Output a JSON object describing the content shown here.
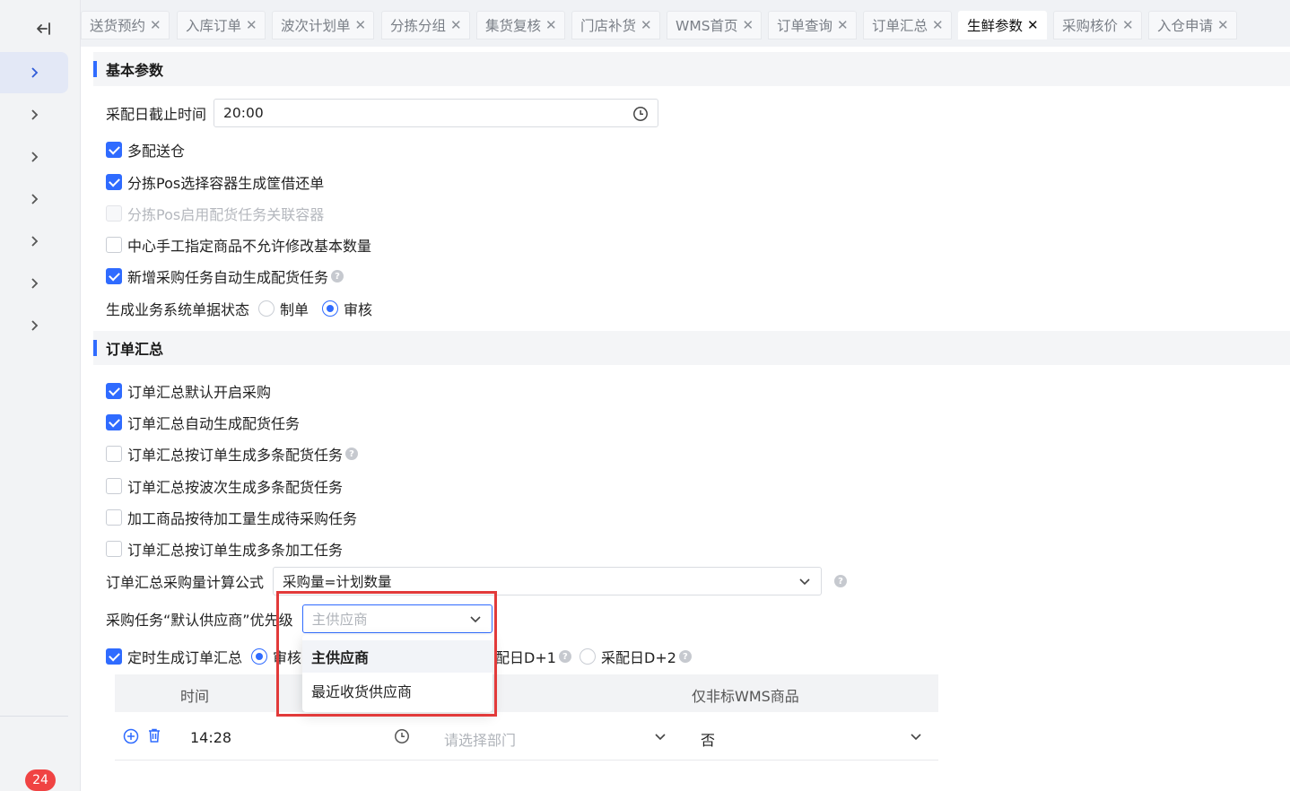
{
  "sidebar": {
    "back_icon": "collapse-left-icon",
    "items": [
      "chevron-right-icon",
      "chevron-right-icon",
      "chevron-right-icon",
      "chevron-right-icon",
      "chevron-right-icon",
      "chevron-right-icon",
      "chevron-right-icon"
    ],
    "badge": "24"
  },
  "tabs": [
    {
      "label": "送货预约"
    },
    {
      "label": "入库订单"
    },
    {
      "label": "波次计划单"
    },
    {
      "label": "分拣分组"
    },
    {
      "label": "集货复核"
    },
    {
      "label": "门店补货"
    },
    {
      "label": "WMS首页"
    },
    {
      "label": "订单查询"
    },
    {
      "label": "订单汇总"
    },
    {
      "label": "生鲜参数",
      "active": true
    },
    {
      "label": "采购核价"
    },
    {
      "label": "入仓申请"
    }
  ],
  "basic": {
    "title": "基本参数",
    "cutoff_label": "采配日截止时间",
    "cutoff_value": "20:00",
    "opt1": "多配送仓",
    "opt2": "分拣Pos选择容器生成筐借还单",
    "opt3": "分拣Pos启用配货任务关联容器",
    "opt4": "中心手工指定商品不允许修改基本数量",
    "opt5": "新增采购任务自动生成配货任务",
    "status_label": "生成业务系统单据状态",
    "status_opt1": "制单",
    "status_opt2": "审核"
  },
  "summary": {
    "title": "订单汇总",
    "opt1": "订单汇总默认开启采购",
    "opt2": "订单汇总自动生成配货任务",
    "opt3": "订单汇总按订单生成多条配货任务",
    "opt4": "订单汇总按波次生成多条配货任务",
    "opt5": "加工商品按待加工量生成待采购任务",
    "opt6": "订单汇总按订单生成多条加工任务",
    "formula_label": "订单汇总采购量计算公式",
    "formula_value": "采购量=计划数量",
    "supplier_label": "采购任务“默认供应商”优先级",
    "supplier_placeholder": "主供应商",
    "timer_label": "定时生成订单汇总",
    "timer_radio1": "审核",
    "timer_radio2_tail": "配日D+1",
    "timer_radio3": "采配日D+2",
    "dropdown_options": [
      "主供应商",
      "最近收货供应商"
    ]
  },
  "table": {
    "headers": {
      "time": "时间",
      "wms": "仅非标WMS商品"
    },
    "row": {
      "time": "14:28",
      "dept_placeholder": "请选择部门",
      "wms": "否"
    }
  },
  "colors": {
    "accent": "#2f6bff",
    "highlight": "#e23a3a",
    "badge": "#f04343"
  }
}
